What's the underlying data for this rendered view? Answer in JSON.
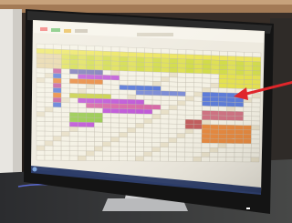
{
  "scene": {
    "subject": "monitor-displaying-schedule-grid",
    "accent_colors": {
      "arrow": "#e0262b",
      "yellow_rows": "#d8e04a",
      "purple_cells": "#c05ad8",
      "orange_cells": "#e8873a",
      "blue_cells": "#5a7ad8",
      "grid_background": "#f4f1e4"
    },
    "grid": {
      "columns": 27,
      "rows": 24
    }
  }
}
